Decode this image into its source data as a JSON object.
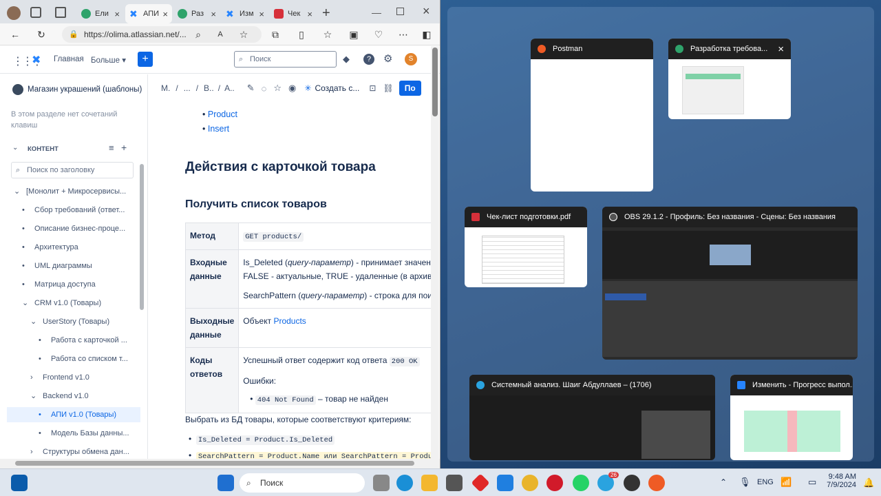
{
  "browser": {
    "tabs": [
      {
        "label": "Ели"
      },
      {
        "label": "АПИ"
      },
      {
        "label": "Раз"
      },
      {
        "label": "Изм"
      },
      {
        "label": "Чек"
      }
    ],
    "url": "https://olima.atlassian.net/..."
  },
  "app": {
    "home": "Главная",
    "more": "Больше",
    "search_placeholder": "Поиск",
    "avatar": "S"
  },
  "sidebar": {
    "space": "Магазин украшений (шаблоны)",
    "notice": "В этом разделе нет сочетаний клавиш",
    "section": "КОНТЕНТ",
    "filter_placeholder": "Поиск по заголовку",
    "items": [
      "[Монолит + Микросервисы...",
      "Сбор требований (ответ...",
      "Описание бизнес-проце...",
      "Архитектура",
      "UML диаграммы",
      "Матрица доступа",
      "CRM v1.0 (Товары)",
      "UserStory (Товары)",
      "Работа с карточкой ...",
      "Работа со списком т...",
      "Frontend v1.0",
      "Backend v1.0",
      "АПИ v1.0 (Товары)",
      "Модель Базы данны...",
      "Структуры обмена дан..."
    ]
  },
  "page": {
    "breadcrumb": [
      "М.",
      "...",
      "В..",
      "А.."
    ],
    "create": "Создать с...",
    "publish": "По",
    "links": [
      "Product",
      "Insert"
    ],
    "h1": "Действия с карточкой товара",
    "h2": "Получить список товаров",
    "table": {
      "method_k": "Метод",
      "method_v": "GET products/",
      "in_k": "Входные данные",
      "in_v1a": "Is_Deleted (",
      "in_v1b": "query-параметр",
      "in_v1c": ") - принимает значения",
      "in_v2": "FALSE - актуальные, TRUE - удаленные (в архиве)",
      "in_v3a": "SearchPattern (",
      "in_v3b": "query-параметр",
      "in_v3c": ") - строка для поиска",
      "out_k": "Выходные данные",
      "out_v1": "Объект ",
      "out_v2": "Products",
      "codes_k": "Коды ответов",
      "codes_v1": "Успешный ответ содержит код ответа ",
      "codes_200": "200 OK",
      "errors": "Ошибки:",
      "e404": "404 Not Found",
      "e404_t": " – товар не найден"
    },
    "para": "Выбрать из БД товары, которые соответствуют критериям:",
    "bullets": [
      "Is_Deleted = Product.Is_Deleted",
      "SearchPattern = Product.Name или SearchPattern = Product.V"
    ]
  },
  "switcher": [
    {
      "title": "Postman"
    },
    {
      "title": "Разработка требова..."
    },
    {
      "title": "Чек-лист подготовки.pdf"
    },
    {
      "title": "OBS 29.1.2 - Профиль: Без названия - Сцены: Без названия"
    },
    {
      "title": "Системный анализ. Шаиг Абдуллаев – (1706)"
    },
    {
      "title": "Изменить - Прогресс выпол..."
    }
  ],
  "taskbar": {
    "search": "Поиск",
    "lang": "ENG",
    "time": "9:48 AM",
    "date": "7/9/2024",
    "badge": "26"
  },
  "colors": {
    "accent": "#0c66e4",
    "jira": "#2684ff"
  }
}
